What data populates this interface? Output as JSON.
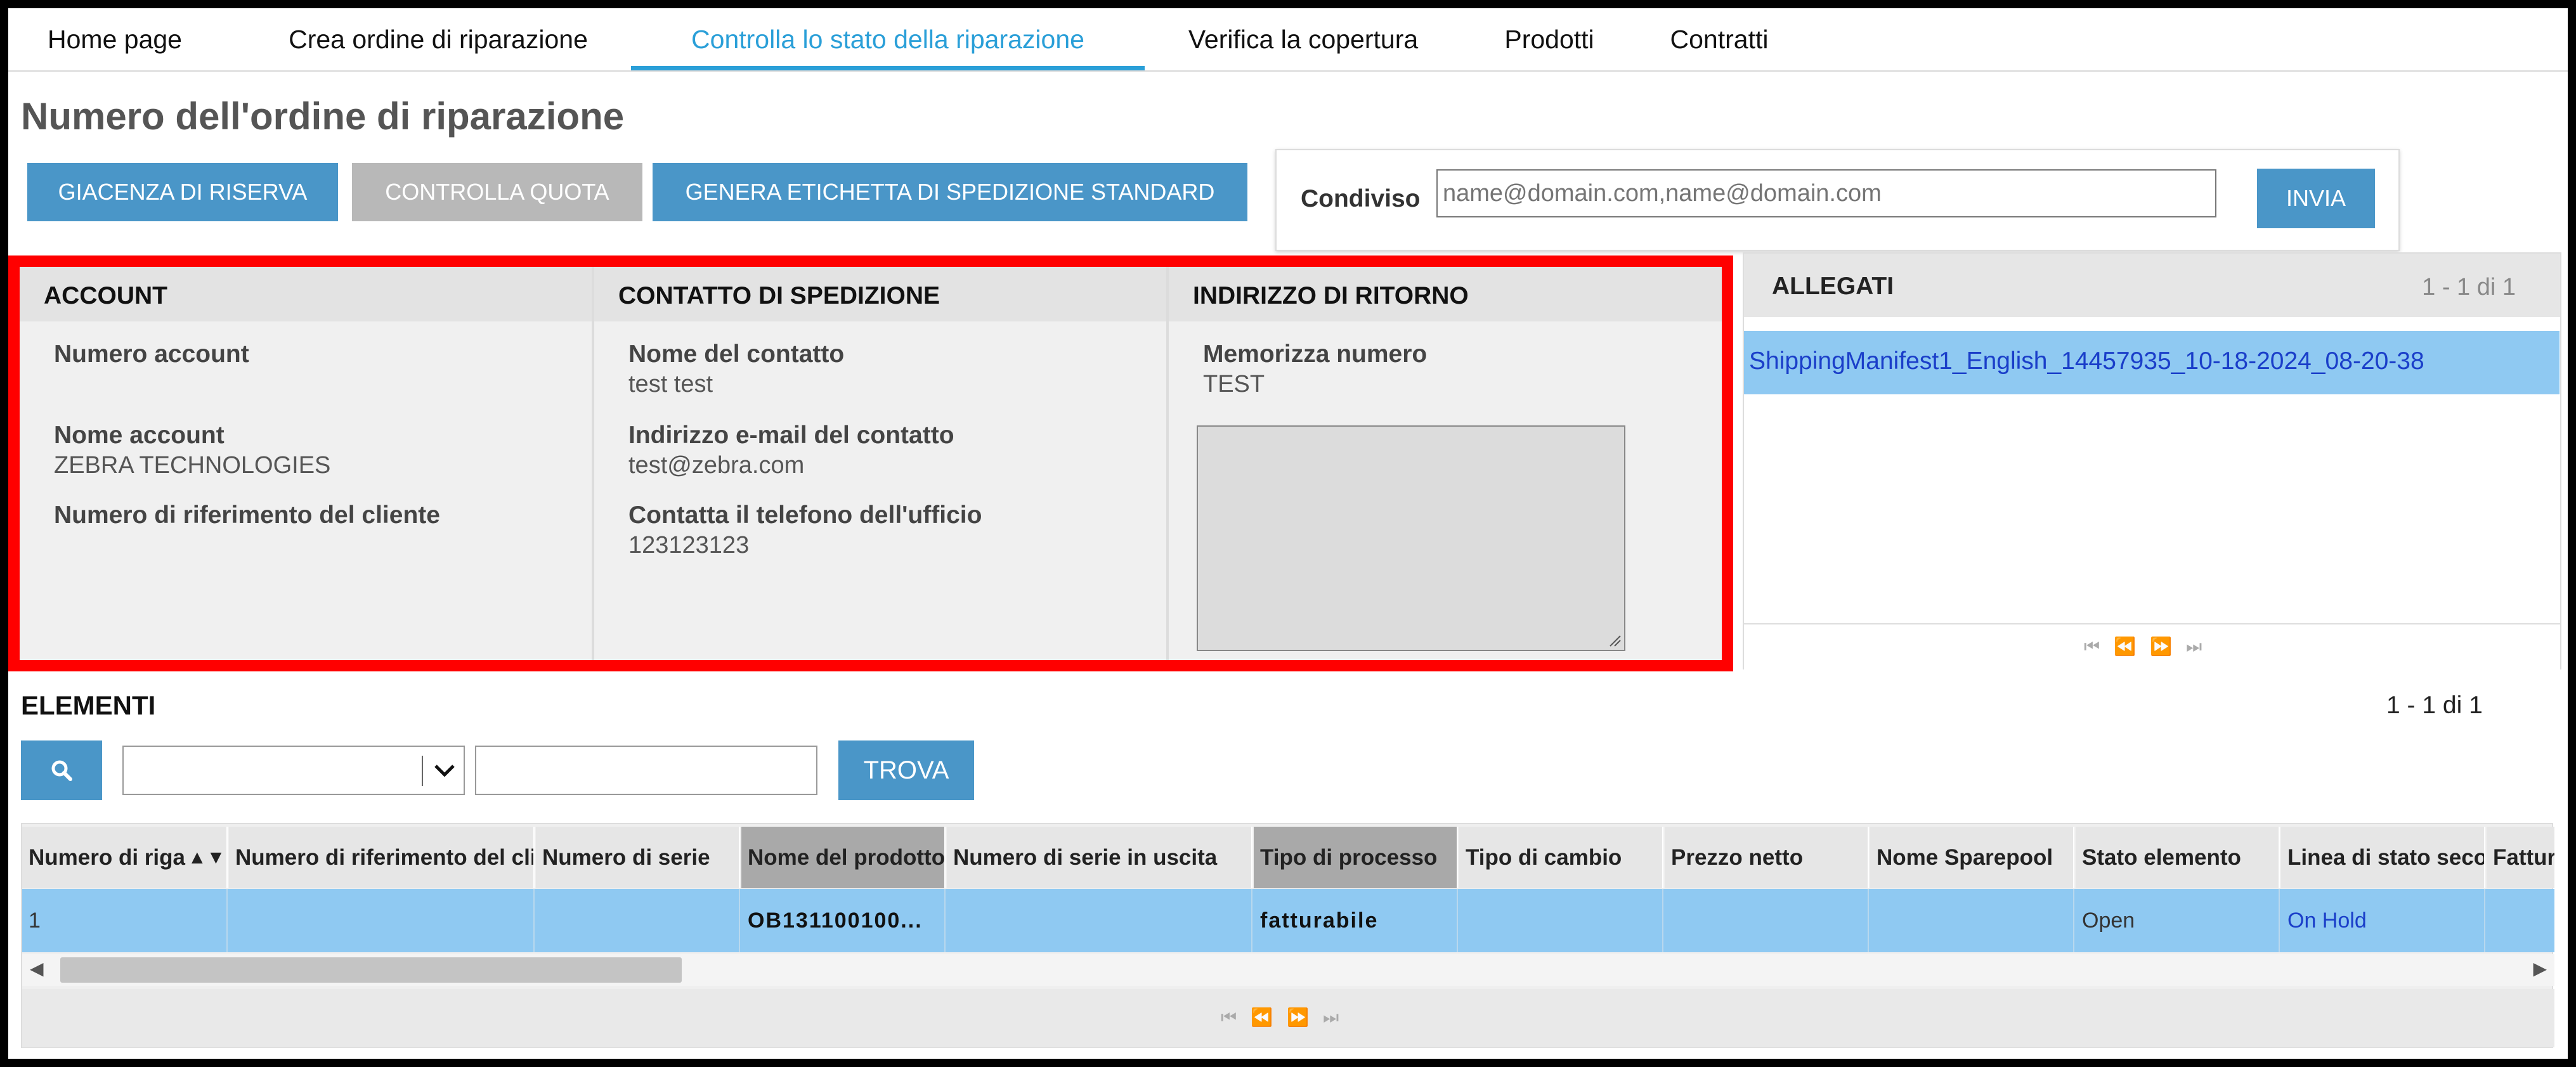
{
  "nav": {
    "tabs": [
      {
        "label": "Home page"
      },
      {
        "label": "Crea ordine di riparazione"
      },
      {
        "label": "Controlla lo stato della riparazione"
      },
      {
        "label": "Verifica la copertura"
      },
      {
        "label": "Prodotti"
      },
      {
        "label": "Contratti"
      }
    ],
    "active_index": 2
  },
  "page_title": "Numero dell'ordine di riparazione",
  "toolbar": {
    "reserve_stock": "GIACENZA DI RISERVA",
    "check_quota": "CONTROLLA QUOTA",
    "generate_label": "GENERA ETICHETTA DI SPEDIZIONE STANDARD"
  },
  "share": {
    "label": "Condiviso",
    "placeholder": "name@domain.com,name@domain.com",
    "send": "INVIA"
  },
  "account": {
    "title": "ACCOUNT",
    "number_label": "Numero account",
    "name_label": "Nome account",
    "name_value": "ZEBRA TECHNOLOGIES",
    "ref_label": "Numero di riferimento del cliente"
  },
  "shipping_contact": {
    "title": "CONTATTO DI SPEDIZIONE",
    "name_label": "Nome del contatto",
    "name_value": "test test",
    "email_label": "Indirizzo e-mail del contatto",
    "email_value": "test@zebra.com",
    "phone_label": "Contatta il telefono dell'ufficio",
    "phone_value": "123123123"
  },
  "return_address": {
    "title": "INDIRIZZO DI RITORNO",
    "store_label": "Memorizza numero",
    "store_value": "TEST"
  },
  "attachments": {
    "title": "ALLEGATI",
    "count": "1 - 1 di 1",
    "items": [
      "ShippingManifest1_English_14457935_10-18-2024_08-20-38"
    ]
  },
  "items": {
    "title": "ELEMENTI",
    "count": "1 - 1 di 1",
    "find": "TROVA",
    "columns": [
      "Numero di riga",
      "Numero di riferimento del cliente",
      "Numero di serie",
      "Nome del prodotto",
      "Numero di serie in uscita",
      "Tipo di processo",
      "Tipo di cambio",
      "Prezzo netto",
      "Nome Sparepool",
      "Stato elemento",
      "Linea di stato secondaria",
      "Fattura"
    ],
    "rows": [
      [
        "1",
        "",
        "",
        "OB131100100...",
        "",
        "fatturabile",
        "",
        "",
        "",
        "Open",
        "On Hold",
        ""
      ]
    ]
  },
  "colors": {
    "accent": "#2a9fd8",
    "button_blue": "#4a96c8",
    "button_disabled": "#b8b8b8",
    "selected_row": "#8fc9f2",
    "highlight_border": "#ff0000",
    "link": "#1a3ec9"
  }
}
